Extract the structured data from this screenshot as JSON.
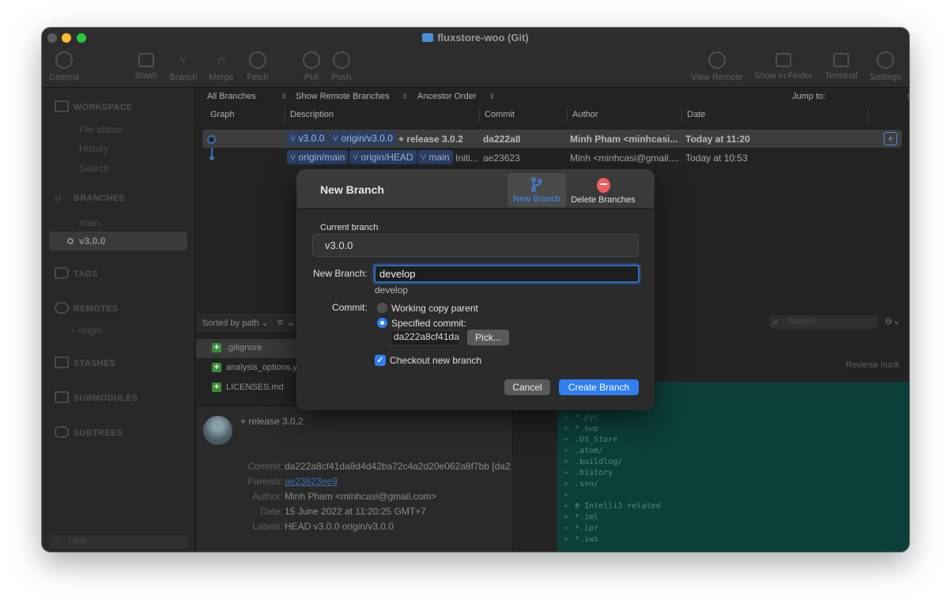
{
  "window": {
    "title": "fluxstore-woo (Git)"
  },
  "toolbar": {
    "commit": "Commit",
    "stash": "Stash",
    "branch": "Branch",
    "merge": "Merge",
    "fetch": "Fetch",
    "pull": "Pull",
    "push": "Push",
    "view_remote": "View Remote",
    "show_in_finder": "Show in Finder",
    "terminal": "Terminal",
    "settings": "Settings"
  },
  "sidebar": {
    "workspace": "WORKSPACE",
    "file_status": "File status",
    "history": "History",
    "search": "Search",
    "branches": "BRANCHES",
    "branch_main": "main",
    "branch_current": "v3.0.0",
    "tags": "TAGS",
    "remotes": "REMOTES",
    "remote_origin": "origin",
    "stashes": "STASHES",
    "submodules": "SUBMODULES",
    "subtrees": "SUBTREES",
    "filter_placeholder": "Filter"
  },
  "filters": {
    "branches": "All Branches",
    "remote": "Show Remote Branches",
    "order": "Ancestor Order",
    "jump": "Jump to:"
  },
  "columns": {
    "graph": "Graph",
    "description": "Description",
    "commit": "Commit",
    "author": "Author",
    "date": "Date"
  },
  "commits": [
    {
      "tags": [
        "v3.0.0",
        "origin/v3.0.0"
      ],
      "message": "+ release 3.0.2",
      "hash": "da222a8",
      "author": "Minh Pham <minhcasi...",
      "date": "Today at 11:20"
    },
    {
      "tags": [
        "origin/main",
        "origin/HEAD",
        "main"
      ],
      "message": "Initi...",
      "hash": "ae23623",
      "author": "Minh <minhcasi@gmail....",
      "date": "Today at 10:53"
    }
  ],
  "filelist": {
    "sort_label": "Sorted by path",
    "files": [
      ".gitignore",
      "analysis_options.y",
      "LICENSES.md"
    ]
  },
  "details": {
    "message": "+ release 3.0.2",
    "commit_label": "Commit:",
    "commit_value": "da222a8cf41da8d4d42ba72c4a2d20e062a8f7bb [da2",
    "parents_label": "Parents:",
    "parents_value": "ae23623ee9",
    "author_label": "Author:",
    "author_value": "Minh Pham <minhcasi@gmail.com>",
    "date_label": "Date:",
    "date_value": "15 June 2022 at 11:20:25 GMT+7",
    "labels_label": "Labels:",
    "labels_value": "HEAD v3.0.0 origin/v3.0.0"
  },
  "diff": {
    "search_placeholder": "Search",
    "reverse_hunk": "Reverse hunk",
    "lines": [
      "*.pyc",
      "*.swp",
      ".DS_Store",
      ".atom/",
      ".buildlog/",
      ".history",
      ".svn/",
      "",
      "# IntelliJ related",
      "*.iml",
      "*.ipr",
      "*.iws"
    ]
  },
  "dialog": {
    "title": "New Branch",
    "tab_new": "New Branch",
    "tab_delete": "Delete Branches",
    "current_label": "Current branch",
    "current_value": "v3.0.0",
    "new_branch_label": "New Branch:",
    "new_branch_value": "develop",
    "new_branch_preview": "develop",
    "commit_label": "Commit:",
    "option_working": "Working copy parent",
    "option_specified": "Specified commit:",
    "specified_value": "da222a8cf41da",
    "pick_button": "Pick...",
    "checkout_label": "Checkout new branch",
    "cancel_button": "Cancel",
    "create_button": "Create Branch"
  },
  "colors": {
    "accent": "#2f7ff0",
    "delete": "#f25d5d",
    "added": "#3e8b3a"
  }
}
